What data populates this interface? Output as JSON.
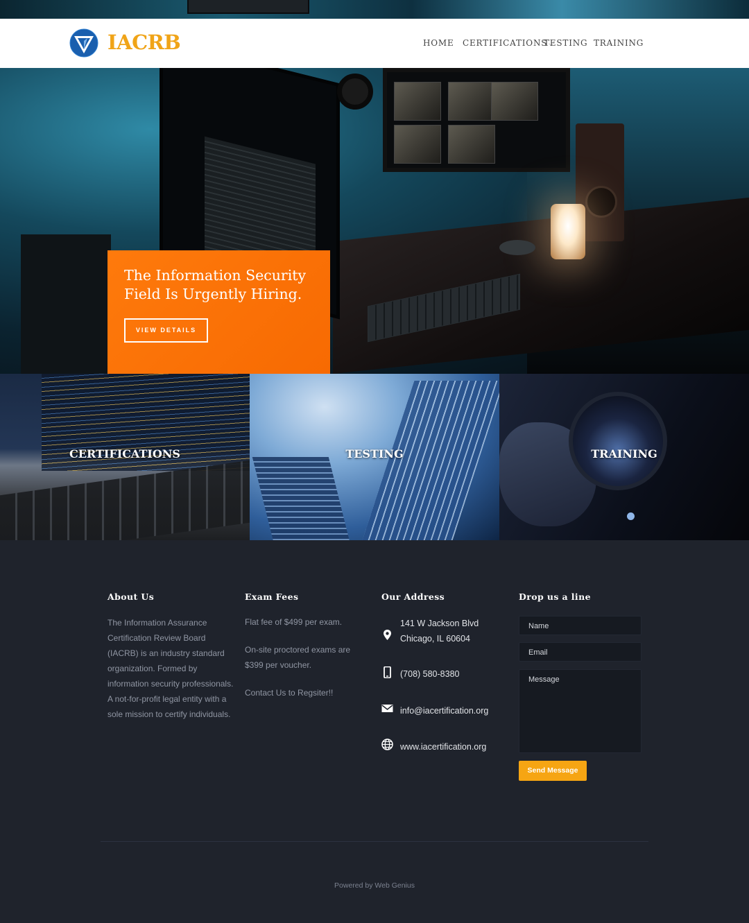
{
  "brand": {
    "name": "IACRB",
    "accent": "#f0a418"
  },
  "nav": {
    "home": "HOME",
    "certifications": "CERTIFICATIONS",
    "testing": "TESTING",
    "training": "TRAINING"
  },
  "hero": {
    "title": "The Information Security Field Is Urgently Hiring.",
    "button": "VIEW DETAILS",
    "card_color": "#fd7205"
  },
  "tiles": [
    {
      "label": "CERTIFICATIONS"
    },
    {
      "label": "TESTING"
    },
    {
      "label": "TRAINING"
    }
  ],
  "footer": {
    "about": {
      "title": "About Us",
      "text": "The Information Assurance Certification Review Board (IACRB) is an industry standard organization. Formed by information security professionals. A not-for-profit legal entity with a sole mission to certify individuals."
    },
    "fees": {
      "title": "Exam Fees",
      "lines": [
        "Flat fee of $499 per exam.",
        "On-site proctored exams are $399 per voucher.",
        "Contact Us to Regsiter!!"
      ]
    },
    "address": {
      "title": "Our Address",
      "street": "141 W Jackson Blvd",
      "city": "Chicago, IL 60604",
      "phone": "(708) 580-8380",
      "email": "info@iacertification.org",
      "website": "www.iacertification.org"
    },
    "contact": {
      "title": "Drop us a line",
      "name_placeholder": "Name",
      "email_placeholder": "Email",
      "message_placeholder": "Message",
      "button": "Send Message",
      "button_color": "#f6a513"
    },
    "powered_by": "Powered by Web Genius"
  }
}
